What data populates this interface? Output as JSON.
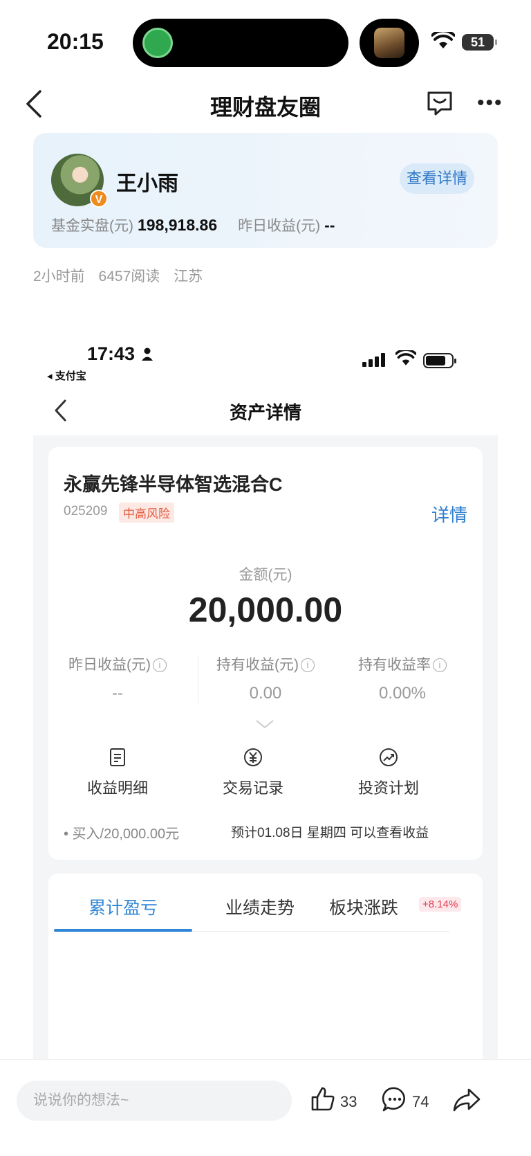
{
  "status_bar": {
    "time": "20:15",
    "battery": "51"
  },
  "nav": {
    "title": "理财盘友圈"
  },
  "user_card": {
    "name": "王小雨",
    "badge": "V",
    "detail_button": "查看详情",
    "fund_label": "基金实盘(元)",
    "fund_value": "198,918.86",
    "yesterday_label": "昨日收益(元)",
    "yesterday_value": "--"
  },
  "post_meta": {
    "time": "2小时前",
    "reads": "6457阅读",
    "location": "江苏"
  },
  "screenshot": {
    "status_time": "17:43",
    "back_app": "◂ 支付宝",
    "title": "资产详情",
    "fund_name": "永赢先锋半导体智选混合C",
    "fund_code": "025209",
    "risk": "中高风险",
    "detail_link": "详情",
    "amount_label": "金额(元)",
    "amount": "20,000.00",
    "stats": [
      {
        "label": "昨日收益(元)",
        "value": "--"
      },
      {
        "label": "持有收益(元)",
        "value": "0.00"
      },
      {
        "label": "持有收益率",
        "value": "0.00%"
      }
    ],
    "actions": [
      {
        "label": "收益明细",
        "icon": "document-icon"
      },
      {
        "label": "交易记录",
        "icon": "yuan-icon"
      },
      {
        "label": "投资计划",
        "icon": "trend-icon"
      }
    ],
    "buy_text": "• 买入/20,000.00元",
    "buy_note": "预计01.08日 星期四 可以查看收益",
    "tabs": [
      {
        "label": "累计盈亏",
        "active": true
      },
      {
        "label": "业绩走势",
        "active": false
      },
      {
        "label": "板块涨跌",
        "active": false
      }
    ],
    "sector_change": "+8.14%"
  },
  "bottom_bar": {
    "comment_placeholder": "说说你的想法~",
    "likes": "33",
    "comments": "74"
  },
  "colors": {
    "accent": "#2f86d4",
    "risk": "#e4583c",
    "badge": "#f0891e"
  }
}
